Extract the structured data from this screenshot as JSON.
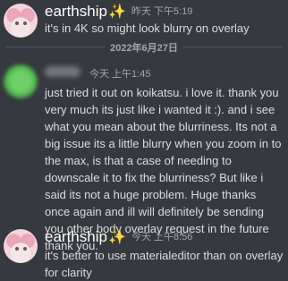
{
  "messages": [
    {
      "username": "earthship",
      "sparkle": "✨",
      "time": "昨天 下午5:19",
      "text": "it's in 4K so might look blurry on overlay"
    },
    {
      "time": "今天 上午1:45",
      "text": "just tried it out on koikatsu. i love it. thank you very much its just like i wanted it :). and i see what you mean about the blurriness. Its not a big issue its a little blurry when you zoom in to the max, is that a case of needing to downscale it to fix the blurriness? But like i said its not a huge problem. Huge thanks once again and ill will definitely be sending you other body overlay request in the future thank you."
    },
    {
      "username": "earthship",
      "sparkle": "✨",
      "time": "今天 上午8:56",
      "text": "it's better to use materialeditor than on overlay for clarity"
    }
  ],
  "date_divider": "2022年6月27日",
  "colors": {
    "background": "#36393f",
    "username": "#ffffff",
    "text": "#dcddde",
    "timestamp": "#a3a6aa",
    "sparkle": "#f7c84a"
  }
}
